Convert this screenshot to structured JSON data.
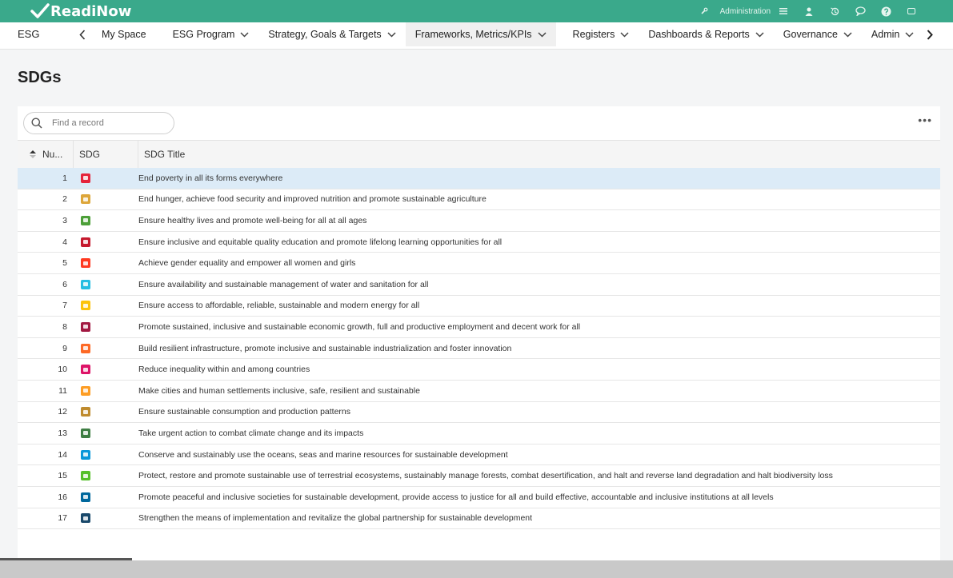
{
  "app": {
    "logo_text": "ReadiNow",
    "admin_label": "Administration",
    "name": "ESG"
  },
  "nav": {
    "items": [
      {
        "label": "My Space",
        "dropdown": false
      },
      {
        "label": "ESG Program",
        "dropdown": true
      },
      {
        "label": "Strategy, Goals & Targets",
        "dropdown": true
      },
      {
        "label": "Frameworks, Metrics/KPIs",
        "dropdown": true,
        "active": true
      },
      {
        "label": "Registers",
        "dropdown": true
      },
      {
        "label": "Dashboards & Reports",
        "dropdown": true
      },
      {
        "label": "Governance",
        "dropdown": true
      },
      {
        "label": "Admin",
        "dropdown": true
      }
    ]
  },
  "page": {
    "title": "SDGs"
  },
  "search": {
    "placeholder": "Find a record"
  },
  "table": {
    "columns": [
      "Nu...",
      "SDG",
      "SDG Title"
    ],
    "rows": [
      {
        "num": "1",
        "color": "#e5243b",
        "title": "End poverty in all its forms everywhere",
        "selected": true
      },
      {
        "num": "2",
        "color": "#dda63a",
        "title": "End hunger, achieve food security and improved nutrition and promote sustainable agriculture"
      },
      {
        "num": "3",
        "color": "#4c9f38",
        "title": "Ensure healthy lives and promote well-being for all at all ages"
      },
      {
        "num": "4",
        "color": "#c5192d",
        "title": "Ensure inclusive and equitable quality education and promote lifelong learning opportunities for all"
      },
      {
        "num": "5",
        "color": "#ff3a21",
        "title": "Achieve gender equality and empower all women and girls"
      },
      {
        "num": "6",
        "color": "#26bde2",
        "title": "Ensure availability and sustainable management of water and sanitation for all"
      },
      {
        "num": "7",
        "color": "#fcc30b",
        "title": "Ensure access to affordable, reliable, sustainable and modern energy for all"
      },
      {
        "num": "8",
        "color": "#a21942",
        "title": "Promote sustained, inclusive and sustainable economic growth, full and productive employment and decent work for all"
      },
      {
        "num": "9",
        "color": "#fd6925",
        "title": "Build resilient infrastructure, promote inclusive and sustainable industrialization and foster innovation"
      },
      {
        "num": "10",
        "color": "#dd1367",
        "title": "Reduce inequality within and among countries"
      },
      {
        "num": "11",
        "color": "#fd9d24",
        "title": "Make cities and human settlements inclusive, safe, resilient and sustainable"
      },
      {
        "num": "12",
        "color": "#bf8b2e",
        "title": "Ensure sustainable consumption and production patterns"
      },
      {
        "num": "13",
        "color": "#3f7e44",
        "title": "Take urgent action to combat climate change and its impacts"
      },
      {
        "num": "14",
        "color": "#0a97d9",
        "title": "Conserve and sustainably use the oceans, seas and marine resources for sustainable development"
      },
      {
        "num": "15",
        "color": "#56c02b",
        "title": "Protect, restore and promote sustainable use of terrestrial ecosystems, sustainably manage forests, combat desertification, and halt and reverse land degradation and halt biodiversity loss"
      },
      {
        "num": "16",
        "color": "#00689d",
        "title": "Promote peaceful and inclusive societies for sustainable development, provide access to justice for all and build effective, accountable and inclusive institutions at all levels"
      },
      {
        "num": "17",
        "color": "#19486a",
        "title": "Strengthen the means of implementation and revitalize the global partnership for sustainable development"
      }
    ]
  }
}
